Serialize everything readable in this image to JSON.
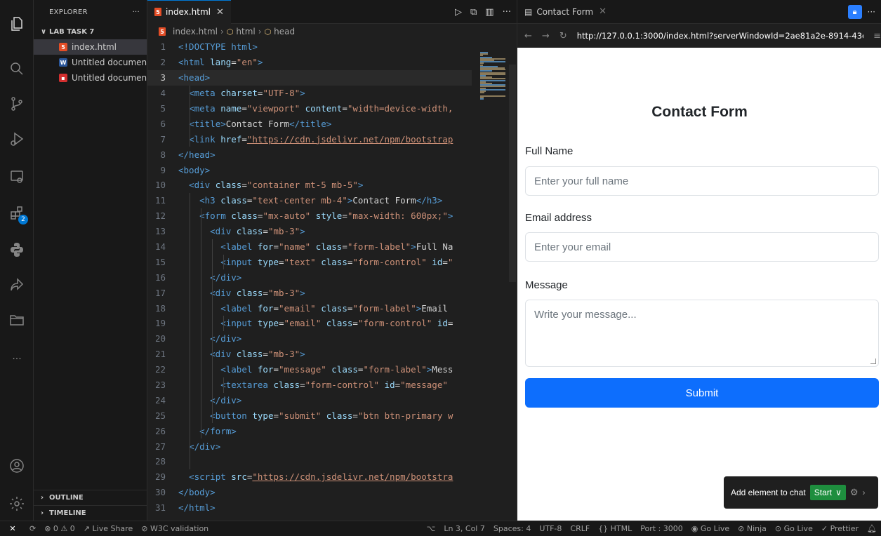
{
  "explorer": {
    "title": "EXPLORER",
    "more": "···",
    "folder": "LAB TASK 7",
    "files": [
      {
        "name": "index.html",
        "icon": "html-file-icon",
        "color": "#e44d26",
        "glyph": "5"
      },
      {
        "name": "Untitled documen...",
        "icon": "word-file-icon",
        "color": "#2b579a",
        "glyph": "W"
      },
      {
        "name": "Untitled documen...",
        "icon": "pdf-file-icon",
        "color": "#d32f2f",
        "glyph": "▪"
      }
    ],
    "outline": "OUTLINE",
    "timeline": "TIMELINE"
  },
  "activity": {
    "extensions_badge": "2",
    "more": "···"
  },
  "editor": {
    "tab_label": "index.html",
    "tab_close": "✕",
    "actions": [
      "▷",
      "⧉",
      "▥",
      "···"
    ],
    "breadcrumb": [
      "index.html",
      "html",
      "head"
    ],
    "current_line": 3,
    "lines": [
      {
        "n": "1",
        "code": [
          [
            "tg",
            "<!DOCTYPE html>"
          ]
        ]
      },
      {
        "n": "2",
        "code": [
          [
            "tg",
            "<html "
          ],
          [
            "at",
            "lang"
          ],
          [
            "pl",
            "="
          ],
          [
            "st",
            "\"en\""
          ],
          [
            "tg",
            ">"
          ]
        ]
      },
      {
        "n": "3",
        "code": [
          [
            "tg",
            "<head>"
          ]
        ]
      },
      {
        "n": "4",
        "code": [
          [
            "pl",
            "  "
          ],
          [
            "tg",
            "<meta "
          ],
          [
            "at",
            "charset"
          ],
          [
            "pl",
            "="
          ],
          [
            "st",
            "\"UTF-8\""
          ],
          [
            "tg",
            ">"
          ]
        ]
      },
      {
        "n": "5",
        "code": [
          [
            "pl",
            "  "
          ],
          [
            "tg",
            "<meta "
          ],
          [
            "at",
            "name"
          ],
          [
            "pl",
            "="
          ],
          [
            "st",
            "\"viewport\""
          ],
          [
            "pl",
            " "
          ],
          [
            "at",
            "content"
          ],
          [
            "pl",
            "="
          ],
          [
            "st",
            "\"width=device-width,"
          ]
        ]
      },
      {
        "n": "6",
        "code": [
          [
            "pl",
            "  "
          ],
          [
            "tg",
            "<title>"
          ],
          [
            "pl",
            "Contact Form"
          ],
          [
            "tg",
            "</title>"
          ]
        ]
      },
      {
        "n": "7",
        "code": [
          [
            "pl",
            "  "
          ],
          [
            "tg",
            "<link "
          ],
          [
            "at",
            "href"
          ],
          [
            "pl",
            "="
          ],
          [
            "ur",
            "\"https://cdn.jsdelivr.net/npm/bootstrap"
          ]
        ]
      },
      {
        "n": "8",
        "code": [
          [
            "tg",
            "</head>"
          ]
        ]
      },
      {
        "n": "9",
        "code": [
          [
            "tg",
            "<body>"
          ]
        ]
      },
      {
        "n": "10",
        "code": [
          [
            "pl",
            "  "
          ],
          [
            "tg",
            "<div "
          ],
          [
            "at",
            "class"
          ],
          [
            "pl",
            "="
          ],
          [
            "st",
            "\"container mt-5 mb-5\""
          ],
          [
            "tg",
            ">"
          ]
        ]
      },
      {
        "n": "11",
        "code": [
          [
            "pl",
            "    "
          ],
          [
            "tg",
            "<h3 "
          ],
          [
            "at",
            "class"
          ],
          [
            "pl",
            "="
          ],
          [
            "st",
            "\"text-center mb-4\""
          ],
          [
            "tg",
            ">"
          ],
          [
            "pl",
            "Contact Form"
          ],
          [
            "tg",
            "</h3>"
          ]
        ]
      },
      {
        "n": "12",
        "code": [
          [
            "pl",
            "    "
          ],
          [
            "tg",
            "<form "
          ],
          [
            "at",
            "class"
          ],
          [
            "pl",
            "="
          ],
          [
            "st",
            "\"mx-auto\""
          ],
          [
            "pl",
            " "
          ],
          [
            "at",
            "style"
          ],
          [
            "pl",
            "="
          ],
          [
            "st",
            "\"max-width: 600px;\""
          ],
          [
            "tg",
            ">"
          ]
        ]
      },
      {
        "n": "13",
        "code": [
          [
            "pl",
            "      "
          ],
          [
            "tg",
            "<div "
          ],
          [
            "at",
            "class"
          ],
          [
            "pl",
            "="
          ],
          [
            "st",
            "\"mb-3\""
          ],
          [
            "tg",
            ">"
          ]
        ]
      },
      {
        "n": "14",
        "code": [
          [
            "pl",
            "        "
          ],
          [
            "tg",
            "<label "
          ],
          [
            "at",
            "for"
          ],
          [
            "pl",
            "="
          ],
          [
            "st",
            "\"name\""
          ],
          [
            "pl",
            " "
          ],
          [
            "at",
            "class"
          ],
          [
            "pl",
            "="
          ],
          [
            "st",
            "\"form-label\""
          ],
          [
            "tg",
            ">"
          ],
          [
            "pl",
            "Full Na"
          ]
        ]
      },
      {
        "n": "15",
        "code": [
          [
            "pl",
            "        "
          ],
          [
            "tg",
            "<input "
          ],
          [
            "at",
            "type"
          ],
          [
            "pl",
            "="
          ],
          [
            "st",
            "\"text\""
          ],
          [
            "pl",
            " "
          ],
          [
            "at",
            "class"
          ],
          [
            "pl",
            "="
          ],
          [
            "st",
            "\"form-control\""
          ],
          [
            "pl",
            " "
          ],
          [
            "at",
            "id"
          ],
          [
            "pl",
            "="
          ],
          [
            "st",
            "\""
          ]
        ]
      },
      {
        "n": "16",
        "code": [
          [
            "pl",
            "      "
          ],
          [
            "tg",
            "</div>"
          ]
        ]
      },
      {
        "n": "17",
        "code": [
          [
            "pl",
            "      "
          ],
          [
            "tg",
            "<div "
          ],
          [
            "at",
            "class"
          ],
          [
            "pl",
            "="
          ],
          [
            "st",
            "\"mb-3\""
          ],
          [
            "tg",
            ">"
          ]
        ]
      },
      {
        "n": "18",
        "code": [
          [
            "pl",
            "        "
          ],
          [
            "tg",
            "<label "
          ],
          [
            "at",
            "for"
          ],
          [
            "pl",
            "="
          ],
          [
            "st",
            "\"email\""
          ],
          [
            "pl",
            " "
          ],
          [
            "at",
            "class"
          ],
          [
            "pl",
            "="
          ],
          [
            "st",
            "\"form-label\""
          ],
          [
            "tg",
            ">"
          ],
          [
            "pl",
            "Email"
          ]
        ]
      },
      {
        "n": "19",
        "code": [
          [
            "pl",
            "        "
          ],
          [
            "tg",
            "<input "
          ],
          [
            "at",
            "type"
          ],
          [
            "pl",
            "="
          ],
          [
            "st",
            "\"email\""
          ],
          [
            "pl",
            " "
          ],
          [
            "at",
            "class"
          ],
          [
            "pl",
            "="
          ],
          [
            "st",
            "\"form-control\""
          ],
          [
            "pl",
            " "
          ],
          [
            "at",
            "id"
          ],
          [
            "pl",
            "="
          ]
        ]
      },
      {
        "n": "20",
        "code": [
          [
            "pl",
            "      "
          ],
          [
            "tg",
            "</div>"
          ]
        ]
      },
      {
        "n": "21",
        "code": [
          [
            "pl",
            "      "
          ],
          [
            "tg",
            "<div "
          ],
          [
            "at",
            "class"
          ],
          [
            "pl",
            "="
          ],
          [
            "st",
            "\"mb-3\""
          ],
          [
            "tg",
            ">"
          ]
        ]
      },
      {
        "n": "22",
        "code": [
          [
            "pl",
            "        "
          ],
          [
            "tg",
            "<label "
          ],
          [
            "at",
            "for"
          ],
          [
            "pl",
            "="
          ],
          [
            "st",
            "\"message\""
          ],
          [
            "pl",
            " "
          ],
          [
            "at",
            "class"
          ],
          [
            "pl",
            "="
          ],
          [
            "st",
            "\"form-label\""
          ],
          [
            "tg",
            ">"
          ],
          [
            "pl",
            "Mess"
          ]
        ]
      },
      {
        "n": "23",
        "code": [
          [
            "pl",
            "        "
          ],
          [
            "tg",
            "<textarea "
          ],
          [
            "at",
            "class"
          ],
          [
            "pl",
            "="
          ],
          [
            "st",
            "\"form-control\""
          ],
          [
            "pl",
            " "
          ],
          [
            "at",
            "id"
          ],
          [
            "pl",
            "="
          ],
          [
            "st",
            "\"message\""
          ]
        ]
      },
      {
        "n": "24",
        "code": [
          [
            "pl",
            "      "
          ],
          [
            "tg",
            "</div>"
          ]
        ]
      },
      {
        "n": "25",
        "code": [
          [
            "pl",
            "      "
          ],
          [
            "tg",
            "<button "
          ],
          [
            "at",
            "type"
          ],
          [
            "pl",
            "="
          ],
          [
            "st",
            "\"submit\""
          ],
          [
            "pl",
            " "
          ],
          [
            "at",
            "class"
          ],
          [
            "pl",
            "="
          ],
          [
            "st",
            "\"btn btn-primary w"
          ]
        ]
      },
      {
        "n": "26",
        "code": [
          [
            "pl",
            "    "
          ],
          [
            "tg",
            "</form>"
          ]
        ]
      },
      {
        "n": "27",
        "code": [
          [
            "pl",
            "  "
          ],
          [
            "tg",
            "</div>"
          ]
        ]
      },
      {
        "n": "28",
        "code": []
      },
      {
        "n": "29",
        "code": [
          [
            "pl",
            "  "
          ],
          [
            "tg",
            "<script "
          ],
          [
            "at",
            "src"
          ],
          [
            "pl",
            "="
          ],
          [
            "ur",
            "\"https://cdn.jsdelivr.net/npm/bootstra"
          ]
        ]
      },
      {
        "n": "30",
        "code": [
          [
            "tg",
            "</body>"
          ]
        ]
      },
      {
        "n": "31",
        "code": [
          [
            "tg",
            "</html>"
          ]
        ]
      }
    ]
  },
  "browser": {
    "tab_label": "Contact Form",
    "tab_close": "✕",
    "back": "←",
    "forward": "→",
    "reload": "↻",
    "url": "http://127.0.0.1:3000/index.html?serverWindowId=2ae81a2e-8914-43ec-8",
    "menu": "≡",
    "more": "···",
    "page": {
      "title": "Contact Form",
      "full_name_label": "Full Name",
      "full_name_placeholder": "Enter your full name",
      "email_label": "Email address",
      "email_placeholder": "Enter your email",
      "message_label": "Message",
      "message_placeholder": "Write your message...",
      "submit": "Submit"
    },
    "chat": {
      "label": "Add element to chat",
      "start": "Start",
      "dropdown": "∨",
      "gear": "⚙",
      "arrow": "›"
    }
  },
  "status": {
    "remote": "✕",
    "problems": "⊗ 0 ⚠ 0",
    "live_share": "Live Share",
    "w3c": "W3C validation",
    "position": "Ln 3, Col 7",
    "spaces": "Spaces: 4",
    "encoding": "UTF-8",
    "eol": "CRLF",
    "language": "{} HTML",
    "port": "Port : 3000",
    "golive1": "Go Live",
    "ninja": "Ninja",
    "golive2": "Go Live",
    "prettier": "Prettier"
  }
}
